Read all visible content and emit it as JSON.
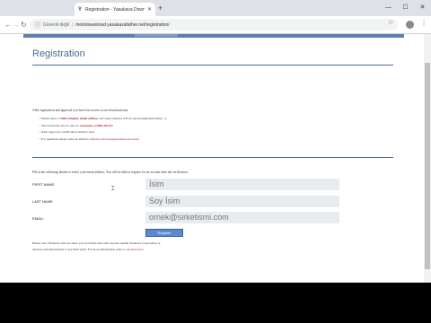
{
  "browser": {
    "tab_title": "Registration - Yasakava Downlo...",
    "tab_icon": "Y",
    "url_security": "Güvenli değil",
    "url": "motolowanload.yasakavafather.net/registration/"
  },
  "page": {
    "title": "Registration",
    "intro": "After registration and approval you have free access to our download area.",
    "bullets": [
      {
        "pre": "Please enter a ",
        "bold": "valid company email address",
        "post": ". All other adresses will be rejected (gmail,hotmail,...)."
      },
      {
        "pre": "The download area is only for ",
        "bold": "customers within the EU",
        "post": ""
      },
      {
        "pre": "After approval a notification email is send",
        "bold": "",
        "post": ""
      },
      {
        "pre": "For questions please write an email to ",
        "link": "software.licensing@yasakava.de/email",
        "post": ""
      }
    ],
    "fill_text": "Fill in the following details to verify your email address. You will be able to register for an account after the verification.",
    "first_name_label": "FIRST NAME:",
    "first_name_placeholder": "İsim",
    "last_name_label": "LAST NAME:",
    "last_name_placeholder": "Soy İsim",
    "email_label": "EMAIL:",
    "email_placeholder": "ornek@sirketismi.com",
    "register_button": "Register",
    "note_1": "Please note: Yasakava will not share your provided data with anyone outside Yasakava Corporation or",
    "note_2_pre": "disclose said information to any third party. For more information refer to our ",
    "note_2_link": "disclosure",
    "note_2_post": "."
  }
}
